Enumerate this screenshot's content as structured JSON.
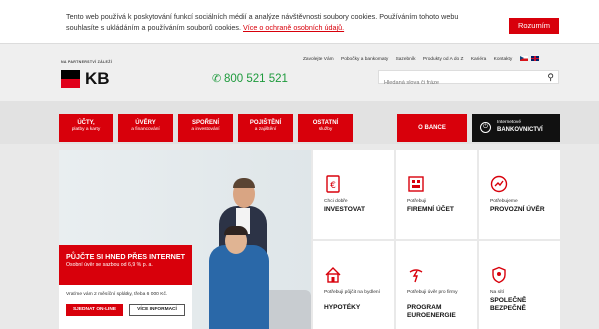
{
  "cookie": {
    "text": "Tento web používá k poskytování funkcí sociálních médií a analýze návštěvnosti soubory cookies. Používáním tohoto webu souhlasíte s ukládáním a používáním souborů cookies.",
    "link": "Více o ochraně osobních údajů.",
    "accept": "Rozumím"
  },
  "header": {
    "partner": "NA PARTNERSTVÍ ZÁLEŽÍ",
    "logo": "KB",
    "phone": "800 521 521",
    "links": [
      "Zavolejte Vám",
      "Pobočky a bankomaty",
      "Sazebník",
      "Produkty od A do Z",
      "Kariéra",
      "Kontakty"
    ],
    "search_placeholder": "Hledaná slova či fráze"
  },
  "nav": {
    "items": [
      {
        "title": "ÚČTY,",
        "sub": "platby a karty"
      },
      {
        "title": "ÚVĚRY",
        "sub": "a financování"
      },
      {
        "title": "SPOŘENÍ",
        "sub": "a investování"
      },
      {
        "title": "POJIŠTĚNÍ",
        "sub": "a zajištění"
      },
      {
        "title": "OSTATNÍ",
        "sub": "služby"
      }
    ],
    "banka": "O BANCE",
    "ib_line1": "Internetové",
    "ib_line2": "BANKOVNICTVÍ"
  },
  "hero": {
    "title": "PŮJČTE SI HNED PŘES INTERNET",
    "subtitle": "Osobní úvěr se sazbou od 6,9 % p. a.",
    "note": "Vraťme vám 2 měsíční splátky, třeba 6 000 Kč.",
    "btn_online": "SJEDNAT ON-LINE",
    "btn_info": "VÍCE INFORMACÍ"
  },
  "tiles": [
    {
      "small": "Chci dobře",
      "big": "INVESTOVAT",
      "icon": "investment-icon"
    },
    {
      "small": "Potřebuji",
      "big": "FIREMNÍ ÚČET",
      "icon": "business-account-icon"
    },
    {
      "small": "Potřebujeme",
      "big": "PROVOZNÍ ÚVĚR",
      "icon": "operating-loan-icon"
    },
    {
      "small": "Potřebuji půjčit na bydlení",
      "big": "HYPOTÉKY",
      "icon": "house-icon"
    },
    {
      "small": "Potřebuji úvěr pro firmy",
      "big": "PROGRAM EUROENERGIE",
      "icon": "energy-icon"
    },
    {
      "small": "Na sítí",
      "big": "SPOLEČNĚ BEZPEČNĚ",
      "icon": "shield-icon"
    }
  ],
  "colors": {
    "brand_red": "#d8000b",
    "phone_green": "#1d9a3c",
    "dark": "#111111"
  }
}
